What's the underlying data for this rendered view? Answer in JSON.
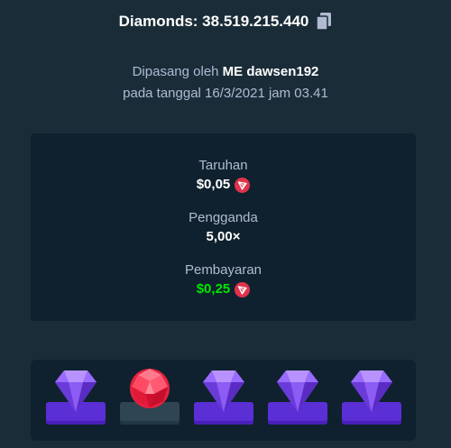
{
  "header": {
    "title": "Diamonds: 38.519.215.440",
    "copy_icon": "copy-icon"
  },
  "placed": {
    "prefix": "Dipasang oleh ",
    "username": "ME dawsen192",
    "date_line": "pada tanggal 16/3/2021 jam 03.41"
  },
  "stats": {
    "bet_label": "Taruhan",
    "bet_value": "$0,05",
    "multiplier_label": "Pengganda",
    "multiplier_value": "5,00×",
    "payout_label": "Pembayaran",
    "payout_value": "$0,25",
    "currency_icon": "tron-icon",
    "colors": {
      "payout": "#00e701",
      "currency": "#e0324b"
    }
  },
  "board": {
    "gems": [
      {
        "type": "purple-gem",
        "result": "win"
      },
      {
        "type": "red-gem",
        "result": "loss"
      },
      {
        "type": "purple-gem",
        "result": "win"
      },
      {
        "type": "purple-gem",
        "result": "win"
      },
      {
        "type": "purple-gem",
        "result": "win"
      }
    ],
    "colors": {
      "purple_gem": "#8c5cf5",
      "red_gem": "#ff3a5c",
      "win_base": "#5b2fd6",
      "loss_base": "#2f4553"
    }
  }
}
